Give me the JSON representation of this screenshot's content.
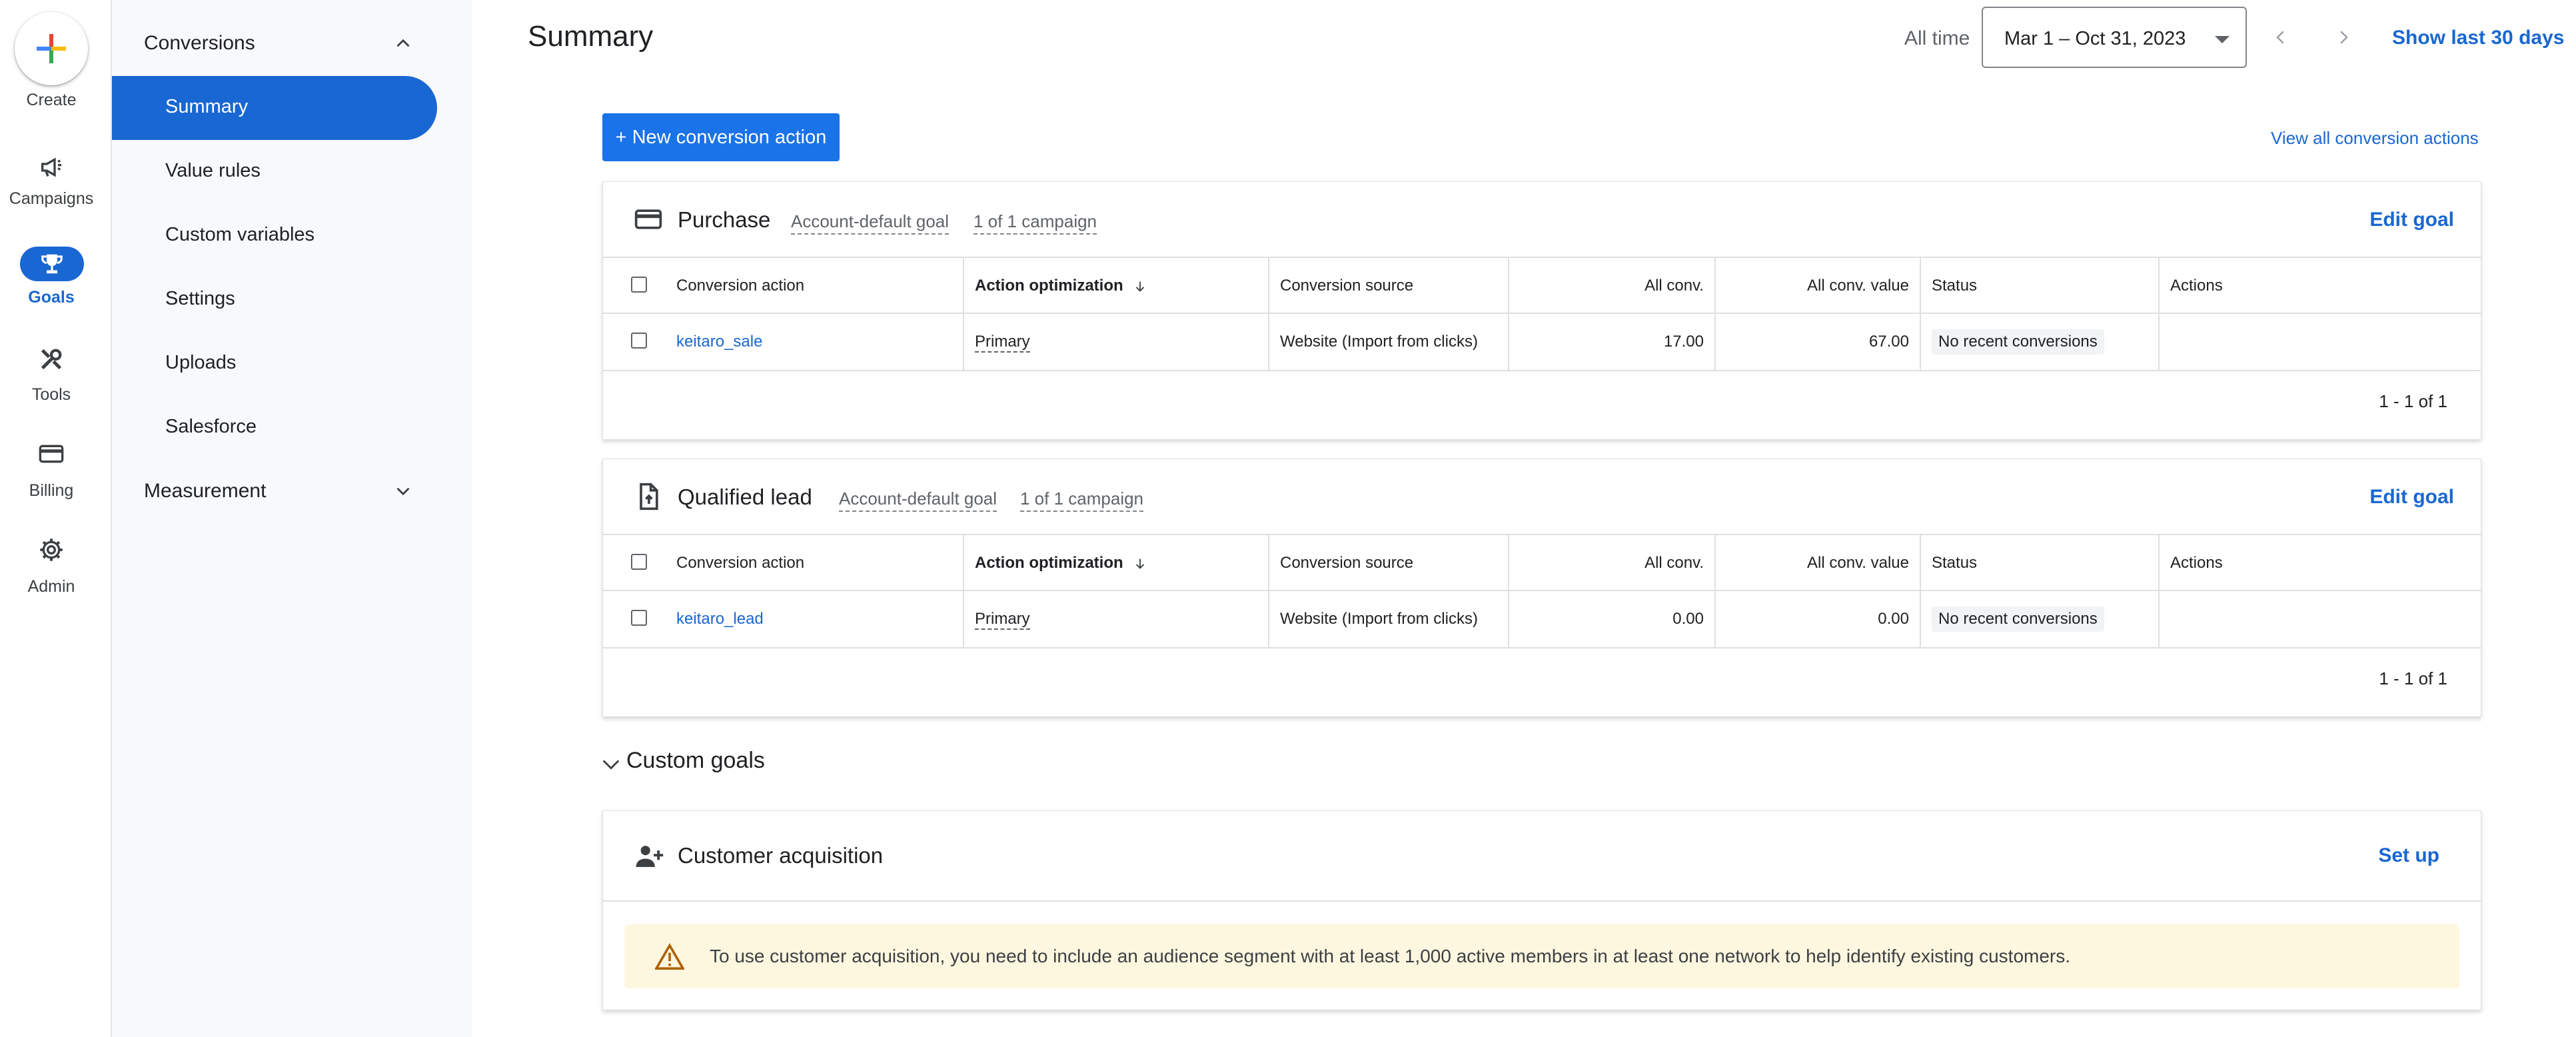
{
  "rail": {
    "create_label": "Create",
    "items": [
      {
        "label": "Campaigns",
        "icon": "megaphone-icon"
      },
      {
        "label": "Goals",
        "icon": "trophy-icon",
        "active": true
      },
      {
        "label": "Tools",
        "icon": "tools-icon"
      },
      {
        "label": "Billing",
        "icon": "credit-card-icon"
      },
      {
        "label": "Admin",
        "icon": "gear-icon"
      }
    ]
  },
  "nav": {
    "section": "Conversions",
    "items": [
      "Summary",
      "Value rules",
      "Custom variables",
      "Settings",
      "Uploads",
      "Salesforce"
    ],
    "active_item": "Summary",
    "measurement": "Measurement"
  },
  "header": {
    "title": "Summary",
    "all_time": "All time",
    "date_range": "Mar 1 – Oct 31, 2023",
    "show_last": "Show last 30 days"
  },
  "actions": {
    "new_conversion": "+ New conversion action",
    "view_all": "View all conversion actions"
  },
  "columns": [
    "Conversion action",
    "Action optimization",
    "Conversion source",
    "All conv.",
    "All conv. value",
    "Status",
    "Actions"
  ],
  "goals": [
    {
      "title": "Purchase",
      "icon": "credit-card-icon",
      "chip_default": "Account-default goal",
      "chip_campaign": "1 of 1 campaign",
      "edit": "Edit goal",
      "row": {
        "action": "keitaro_sale",
        "optimization": "Primary",
        "source": "Website (Import from clicks)",
        "conv": "17.00",
        "value": "67.00",
        "status": "No recent conversions"
      },
      "pager": "1 - 1 of 1"
    },
    {
      "title": "Qualified lead",
      "icon": "document-upload-icon",
      "chip_default": "Account-default goal",
      "chip_campaign": "1 of 1 campaign",
      "edit": "Edit goal",
      "row": {
        "action": "keitaro_lead",
        "optimization": "Primary",
        "source": "Website (Import from clicks)",
        "conv": "0.00",
        "value": "0.00",
        "status": "No recent conversions"
      },
      "pager": "1 - 1 of 1"
    }
  ],
  "custom_goals": {
    "label": "Custom goals",
    "acquisition": {
      "title": "Customer acquisition",
      "setup": "Set up",
      "warning": "To use customer acquisition, you need to include an audience segment with at least 1,000 active members in at least one network to help identify existing customers."
    }
  },
  "colors": {
    "primary": "#1967d2",
    "button": "#1a73e8",
    "warning_bg": "#fef7e0",
    "warning_icon": "#b06000"
  }
}
